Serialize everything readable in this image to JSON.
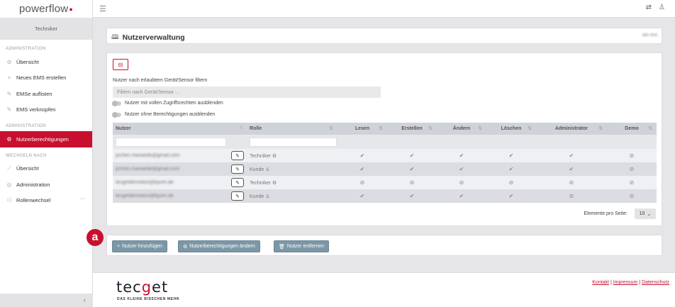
{
  "app": {
    "logo": "powerflow",
    "role": "Techniker"
  },
  "sidebar": {
    "sections": [
      {
        "title": "ADMINISTRATION",
        "items": [
          {
            "label": "Übersicht",
            "icon": "check-circle-icon"
          },
          {
            "label": "Neues EMS erstellen",
            "icon": "plus-icon"
          },
          {
            "label": "EMSe auflisten",
            "icon": "pencil-icon"
          },
          {
            "label": "EMS verknüpfen",
            "icon": "link-icon"
          }
        ]
      },
      {
        "title": "ADMINISTRATION",
        "items": [
          {
            "label": "Nutzerberechtigungen",
            "icon": "gear-icon",
            "active": true
          }
        ]
      },
      {
        "title": "WECHSELN NACH",
        "items": [
          {
            "label": "Übersicht",
            "icon": "chart-icon"
          },
          {
            "label": "Administration",
            "icon": "settings-icon"
          },
          {
            "label": "Rollenwechsel",
            "icon": "users-icon"
          }
        ]
      }
    ]
  },
  "page": {
    "title": "Nutzerverwaltung",
    "env": "dev test"
  },
  "filter": {
    "label": "Nutzer nach erlaubtem Gerät/Sensor filtern",
    "placeholder": "Filtern nach Gerät/Sensor ...",
    "toggle1": "Nutzer mit vollen Zugriffsrechten ausblenden",
    "toggle2": "Nutzer ohne Berechtigungen ausblenden"
  },
  "table": {
    "headers": [
      "Nutzer",
      "Rolle",
      "Lesen",
      "Erstellen",
      "Ändern",
      "Löschen",
      "Administrator",
      "Demo"
    ],
    "rows": [
      {
        "user": "jochen.marwede@gmail.com",
        "role": "Techniker",
        "perms": [
          true,
          true,
          true,
          true,
          true,
          false
        ]
      },
      {
        "user": "jochen.marwede@gmail.com",
        "role": "Kunde",
        "perms": [
          true,
          true,
          true,
          true,
          true,
          false
        ]
      },
      {
        "user": "tecgetdemobox@byom.de",
        "role": "Techniker",
        "perms": [
          false,
          false,
          false,
          false,
          false,
          false
        ]
      },
      {
        "user": "tecgetdemobox@byom.de",
        "role": "Kunde",
        "perms": [
          true,
          true,
          true,
          true,
          false,
          false
        ]
      }
    ]
  },
  "pagination": {
    "label": "Elemente pro Seite:",
    "value": "10"
  },
  "actions": {
    "add": "Nutzer hinzufügen",
    "change": "Nutzerberechtigungen ändern",
    "remove": "Nutzer entfernen"
  },
  "badge": "a",
  "footer": {
    "logo": "tecget",
    "slogan": "DAS KLEINE BISSCHEN MEHR",
    "links": [
      "Kontakt",
      "Impressum",
      "Datenschutz"
    ]
  }
}
